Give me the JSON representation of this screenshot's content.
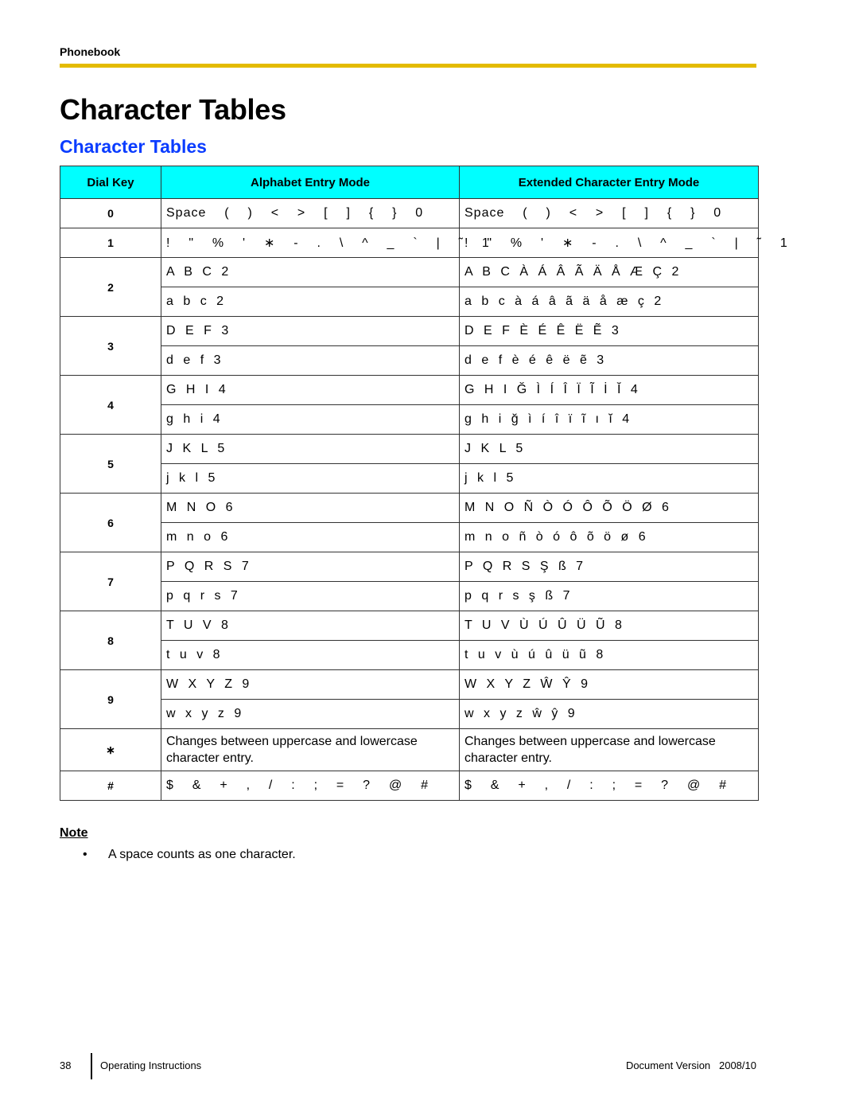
{
  "header": {
    "section_label": "Phonebook",
    "page_title": "Character Tables",
    "section_title": "Character Tables"
  },
  "table": {
    "columns": [
      "Dial Key",
      "Alphabet Entry Mode",
      "Extended Character Entry Mode"
    ],
    "rows": [
      {
        "key": "0",
        "entries": [
          {
            "alphabet": "Space  (  )  <  >  [  ]  {  }  0",
            "extended": "Space  (  )  <  >  [  ]  {  }  0"
          }
        ]
      },
      {
        "key": "1",
        "entries": [
          {
            "alphabet": "!  \"  %  '  ∗  -  .  \\  ^  _  `  |  ˜  1",
            "extended": "!  \"  %  '  ∗  -  .  \\  ^  _  `  |  ˜  1"
          }
        ]
      },
      {
        "key": "2",
        "entries": [
          {
            "alphabet": "A B C 2",
            "extended": "A B C À Á Â Ã Ä Å Æ Ç 2"
          },
          {
            "alphabet": "a b c 2",
            "extended": "a b c à á â ã ä å æ ç 2"
          }
        ]
      },
      {
        "key": "3",
        "entries": [
          {
            "alphabet": "D E F 3",
            "extended": "D E F È É Ê Ë Ẽ 3"
          },
          {
            "alphabet": "d e f 3",
            "extended": "d e f è é ê ë ẽ 3"
          }
        ]
      },
      {
        "key": "4",
        "entries": [
          {
            "alphabet": "G H I 4",
            "extended": "G H I Ğ Ì Í Î Ï Ĩ İ Ĭ 4"
          },
          {
            "alphabet": "g h i 4",
            "extended": "g h i ğ ì í î ï ĩ ı ĭ 4"
          }
        ]
      },
      {
        "key": "5",
        "entries": [
          {
            "alphabet": "J K L 5",
            "extended": "J K L 5"
          },
          {
            "alphabet": "j k l 5",
            "extended": "j k l 5"
          }
        ]
      },
      {
        "key": "6",
        "entries": [
          {
            "alphabet": "M N O 6",
            "extended": "M N O Ñ Ò Ó Ô Õ Ö Ø 6"
          },
          {
            "alphabet": "m n o 6",
            "extended": "m n o ñ ò ó ô õ ö ø 6"
          }
        ]
      },
      {
        "key": "7",
        "entries": [
          {
            "alphabet": "P Q R S 7",
            "extended": "P Q R S Ş ß 7"
          },
          {
            "alphabet": "p q r s 7",
            "extended": "p q r s ş ß 7"
          }
        ]
      },
      {
        "key": "8",
        "entries": [
          {
            "alphabet": "T U V 8",
            "extended": "T U V Ù Ú Û Ü Ũ 8"
          },
          {
            "alphabet": "t u v 8",
            "extended": "t u v ù ú û ü ũ 8"
          }
        ]
      },
      {
        "key": "9",
        "entries": [
          {
            "alphabet": "W X Y Z 9",
            "extended": "W X Y Z Ŵ Ŷ 9"
          },
          {
            "alphabet": "w x y z 9",
            "extended": "w x y z ŵ ŷ 9"
          }
        ]
      },
      {
        "key": "∗",
        "desc": true,
        "entries": [
          {
            "alphabet": "Changes between uppercase and lowercase character entry.",
            "extended": "Changes between uppercase and lowercase character entry."
          }
        ]
      },
      {
        "key": "#",
        "entries": [
          {
            "alphabet": "$  &  +  ,  /  :  ;  =  ?  @  #",
            "extended": "$  &  +  ,  /  :  ;  =  ?  @  #"
          }
        ]
      }
    ]
  },
  "note": {
    "heading": "Note",
    "items": [
      "A space counts as one character."
    ]
  },
  "footer": {
    "page_number": "38",
    "left": "Operating Instructions",
    "right": "Document Version   2008/10"
  }
}
